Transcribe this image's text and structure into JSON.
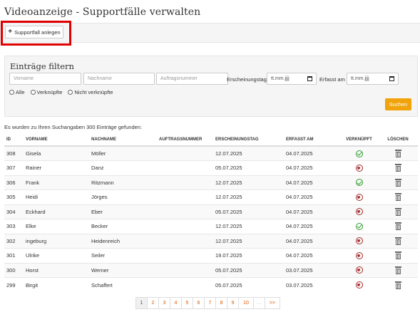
{
  "page": {
    "title": "Videoanzeige - Supportfälle verwalten"
  },
  "toolbar": {
    "new_case_label": "Supportfall anlegen",
    "new_case_icon": "plus-icon"
  },
  "filter": {
    "heading": "Einträge filtern",
    "firstname_placeholder": "Vorname",
    "lastname_placeholder": "Nachname",
    "order_placeholder": "Auftragsnummer",
    "release_date_label": "Erscheinungstag",
    "release_date_value": "tt.mm.jjjj",
    "captured_label": "Erfasst am",
    "captured_value": "tt.mm.jjjj",
    "radio_all": "Alle",
    "radio_linked": "Verknüpfte",
    "radio_unlinked": "Nicht verknüpfte",
    "search_label": "Suchen",
    "search_color": "#f0a30a"
  },
  "results": {
    "info": "Es wurden zu Ihren Suchangaben 300 Einträge gefunden:"
  },
  "table": {
    "headers": {
      "id": "ID",
      "firstname": "VORNAME",
      "lastname": "NACHNAME",
      "order": "AUFTRAGSNUMMER",
      "release": "ERSCHEINUNGSTAG",
      "captured": "ERFASST AM",
      "linked": "VERKNÜPFT",
      "delete": "LÖSCHEN"
    },
    "rows": [
      {
        "id": "308",
        "firstname": "Gisela",
        "lastname": "Möller",
        "order": "",
        "release": "12.07.2025",
        "captured": "04.07.2025",
        "linked": true
      },
      {
        "id": "307",
        "firstname": "Rainer",
        "lastname": "Danz",
        "order": "",
        "release": "05.07.2025",
        "captured": "04.07.2025",
        "linked": false
      },
      {
        "id": "306",
        "firstname": "Frank",
        "lastname": "Ritzmann",
        "order": "",
        "release": "12.07.2025",
        "captured": "04.07.2025",
        "linked": true
      },
      {
        "id": "305",
        "firstname": "Heidi",
        "lastname": "Jörges",
        "order": "",
        "release": "12.07.2025",
        "captured": "04.07.2025",
        "linked": false
      },
      {
        "id": "304",
        "firstname": "Eckhard",
        "lastname": "Eber",
        "order": "",
        "release": "05.07.2025",
        "captured": "04.07.2025",
        "linked": false
      },
      {
        "id": "303",
        "firstname": "Elke",
        "lastname": "Becker",
        "order": "",
        "release": "12.07.2025",
        "captured": "04.07.2025",
        "linked": true
      },
      {
        "id": "302",
        "firstname": "ingeburg",
        "lastname": "Heidenreich",
        "order": "",
        "release": "12.07.2025",
        "captured": "04.07.2025",
        "linked": false
      },
      {
        "id": "301",
        "firstname": "Ulrike",
        "lastname": "Seiler",
        "order": "",
        "release": "19.07.2025",
        "captured": "04.07.2025",
        "linked": false
      },
      {
        "id": "300",
        "firstname": "Horst",
        "lastname": "Werner",
        "order": "",
        "release": "05.07.2025",
        "captured": "03.07.2025",
        "linked": false
      },
      {
        "id": "299",
        "firstname": "Birgit",
        "lastname": "Schaffert",
        "order": "",
        "release": "05.07.2025",
        "captured": "03.07.2025",
        "linked": false
      }
    ],
    "linked_icon": "check-circle-icon",
    "unlinked_icon": "x-circle-icon",
    "delete_icon": "trash-icon"
  },
  "pagination": {
    "pages": [
      "1",
      "2",
      "3",
      "4",
      "5",
      "6",
      "7",
      "8",
      "9",
      "10"
    ],
    "ellipsis": "...",
    "next": ">>",
    "active_page": "1",
    "link_color": "#e05a00"
  }
}
